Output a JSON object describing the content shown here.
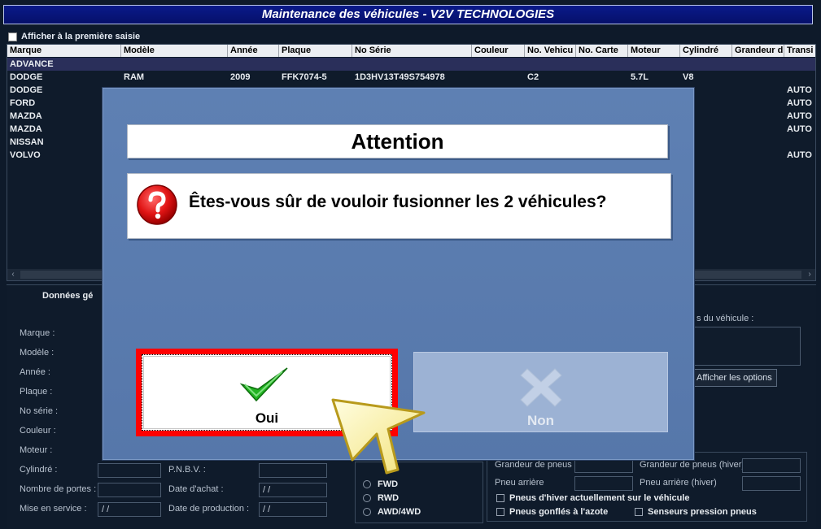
{
  "window": {
    "title": "Maintenance des véhicules - V2V TECHNOLOGIES"
  },
  "options": {
    "show_first_entry": "Afficher à la première saisie"
  },
  "grid": {
    "columns": [
      "Marque",
      "Modèle",
      "Année",
      "Plaque",
      "No Série",
      "Couleur",
      "No. Vehicu",
      "No. Carte",
      "Moteur",
      "Cylindré",
      "Grandeur d",
      "Transi"
    ],
    "rows": [
      {
        "marque": "ADVANCE",
        "modele": "",
        "annee": "",
        "plaque": "",
        "serie": "",
        "novehicule": "",
        "moteur": "",
        "cylindre": "",
        "trans": ""
      },
      {
        "marque": "DODGE",
        "modele": "RAM",
        "annee": "2009",
        "plaque": "FFK7074-5",
        "serie": "1D3HV13T49S754978",
        "novehicule": "C2",
        "moteur": "5.7L",
        "cylindre": "V8",
        "trans": ""
      },
      {
        "marque": "DODGE",
        "modele": "",
        "annee": "",
        "plaque": "",
        "serie": "",
        "novehicule": "",
        "moteur": "",
        "cylindre": "",
        "trans": "AUTO"
      },
      {
        "marque": "FORD",
        "modele": "",
        "annee": "",
        "plaque": "",
        "serie": "",
        "novehicule": "",
        "moteur": "",
        "cylindre": "",
        "trans": "AUTO"
      },
      {
        "marque": "MAZDA",
        "modele": "",
        "annee": "",
        "plaque": "",
        "serie": "",
        "novehicule": "",
        "moteur": "",
        "cylindre": "",
        "trans": "AUTO"
      },
      {
        "marque": "MAZDA",
        "modele": "",
        "annee": "",
        "plaque": "",
        "serie": "",
        "novehicule": "",
        "moteur": "",
        "cylindre": "",
        "trans": "AUTO"
      },
      {
        "marque": "NISSAN",
        "modele": "",
        "annee": "",
        "plaque": "",
        "serie": "",
        "novehicule": "",
        "moteur": "",
        "cylindre": "",
        "trans": ""
      },
      {
        "marque": "VOLVO",
        "modele": "",
        "annee": "",
        "plaque": "",
        "serie": "",
        "novehicule": "",
        "moteur": "",
        "cylindre": "",
        "trans": "AUTO"
      }
    ]
  },
  "form": {
    "tab_label": "Données gé",
    "labels": {
      "marque": "Marque :",
      "modele": "Modèle :",
      "annee": "Année :",
      "plaque": "Plaque :",
      "serie": "No série :",
      "couleur": "Couleur :",
      "moteur": "Moteur :",
      "cylindre": "Cylindré :",
      "portes": "Nombre de portes :",
      "service": "Mise en service :",
      "pnbv": "P.N.B.V. :",
      "achat": "Date d'achat :",
      "production": "Date de production :",
      "options_title": "s du véhicule :"
    },
    "values": {
      "achat": " /  /",
      "service": " /  /",
      "production": " /  /"
    },
    "show_options_button": "Afficher les options",
    "drive": [
      "FWD",
      "RWD",
      "AWD/4WD"
    ],
    "tires": {
      "size": "Grandeur de pneus",
      "size_winter": "Grandeur de pneus (hiver)",
      "rear": "Pneu arrière",
      "rear_winter": "Pneu arrière (hiver)",
      "winter_on": "Pneus d'hiver actuellement sur le véhicule",
      "nitrogen": "Pneus gonflés à l'azote",
      "pressure_sensors": "Senseurs pression pneus"
    }
  },
  "dialog": {
    "title": "Attention",
    "message": "Êtes-vous sûr de vouloir fusionner les 2 véhicules?",
    "icon": "question-icon",
    "yes_label": "Oui",
    "no_label": "Non"
  },
  "colors": {
    "title_bg": "#0a1a8a",
    "dialog_bg": "#5e80b3",
    "highlight": "#ff0000",
    "check": "#22b422"
  }
}
